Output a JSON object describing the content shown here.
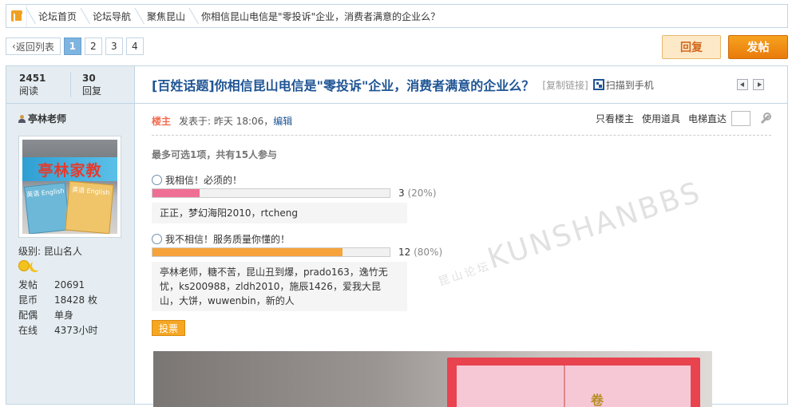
{
  "breadcrumb": {
    "items": [
      {
        "label": "论坛首页"
      },
      {
        "label": "论坛导航"
      },
      {
        "label": "聚焦昆山"
      },
      {
        "label": "你相信昆山电信是\"零投诉\"企业，消费者满意的企业么？"
      }
    ]
  },
  "pager": {
    "back_label": "返回列表",
    "pages": [
      "1",
      "2",
      "3",
      "4"
    ],
    "current": "1"
  },
  "actions": {
    "reply_label": "回复",
    "post_label": "发帖"
  },
  "stats": {
    "views": "2451",
    "views_label": "阅读",
    "replies": "30",
    "replies_label": "回复"
  },
  "thread": {
    "title": "[百姓话题]你相信昆山电信是\"零投诉\"企业，消费者满意的企业么？",
    "copy_link": "[复制链接]",
    "scan_label": "扫描到手机"
  },
  "author": {
    "name": "亭林老师",
    "avatar_text": "亭林家教",
    "avatar_book1": "英语 English",
    "avatar_book2": "英语 English",
    "level": "级别: 昆山名人",
    "profile": [
      {
        "k": "发帖",
        "v": "20691"
      },
      {
        "k": "昆币",
        "v": "18428 枚"
      },
      {
        "k": "配偶",
        "v": "单身"
      },
      {
        "k": "在线",
        "v": "4373小时"
      }
    ]
  },
  "post": {
    "op_label": "楼主",
    "posted": "发表于: 昨天 18:06",
    "separator": "，",
    "edit_label": "编辑",
    "tools": {
      "only_op": "只看楼主",
      "use_item": "使用道具",
      "elevator": "电梯直达"
    }
  },
  "poll": {
    "header": "最多可选1项，共有15人参与",
    "options": [
      {
        "label": "我相信！必须的！",
        "count": "3",
        "percent": "(20%)",
        "fraction": 0.2,
        "color": "#ef6f94",
        "voters": "正正，梦幻海阳2010，rtcheng"
      },
      {
        "label": "我不相信！服务质量你懂的！",
        "count": "12",
        "percent": "(80%)",
        "fraction": 0.8,
        "color": "#f5a33a",
        "voters": "亭林老师，糖不苦，昆山丑到爆，prado163，逸竹无忧，ks200988，zldh2010，施辰1426，爱我大昆山，大饼，wuwenbin，新的人"
      }
    ],
    "vote_label": "投票"
  },
  "watermark": {
    "brand": "KUNSHANBBS",
    "cn": "昆山论坛"
  },
  "image_text": "卷"
}
